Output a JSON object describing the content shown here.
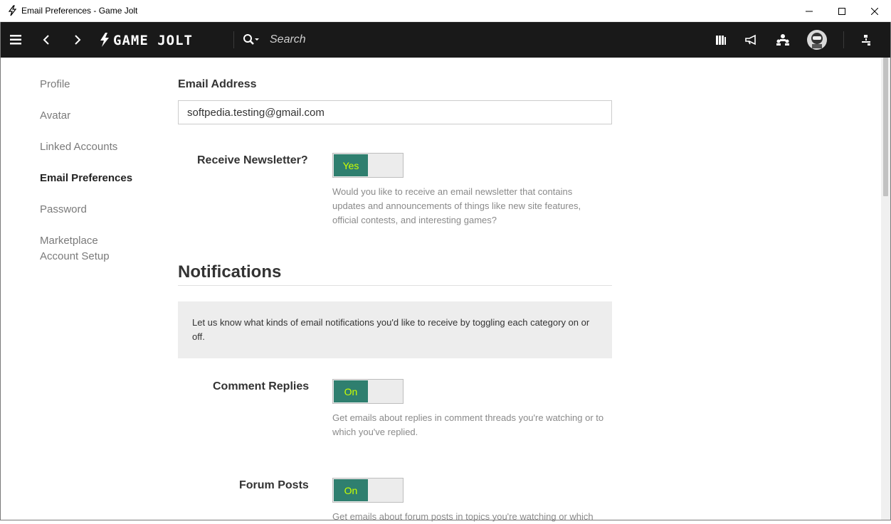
{
  "window": {
    "title": "Email Preferences - Game Jolt"
  },
  "navbar": {
    "search_placeholder": "Search",
    "logo_text": "GAME JOLT"
  },
  "sidebar": {
    "items": [
      {
        "label": "Profile"
      },
      {
        "label": "Avatar"
      },
      {
        "label": "Linked Accounts"
      },
      {
        "label": "Email Preferences"
      },
      {
        "label": "Password"
      },
      {
        "label": "Marketplace\nAccount Setup"
      }
    ]
  },
  "main": {
    "email_label": "Email Address",
    "email_value": "softpedia.testing@gmail.com",
    "newsletter": {
      "label": "Receive Newsletter?",
      "toggle": "Yes",
      "help": "Would you like to receive an email newsletter that contains updates and announcements of things like new site features, official contests, and interesting games?"
    },
    "notifications_title": "Notifications",
    "notifications_info": "Let us know what kinds of email notifications you'd like to receive by toggling each category on or off.",
    "comment_replies": {
      "label": "Comment Replies",
      "toggle": "On",
      "help": "Get emails about replies in comment threads you're watching or to which you've replied."
    },
    "forum_posts": {
      "label": "Forum Posts",
      "toggle": "On",
      "help": "Get emails about forum posts in topics you're watching or which"
    }
  },
  "colors": {
    "navbar_bg": "#191919",
    "toggle_on": "#2f7f6f",
    "toggle_text": "#ccff00"
  }
}
